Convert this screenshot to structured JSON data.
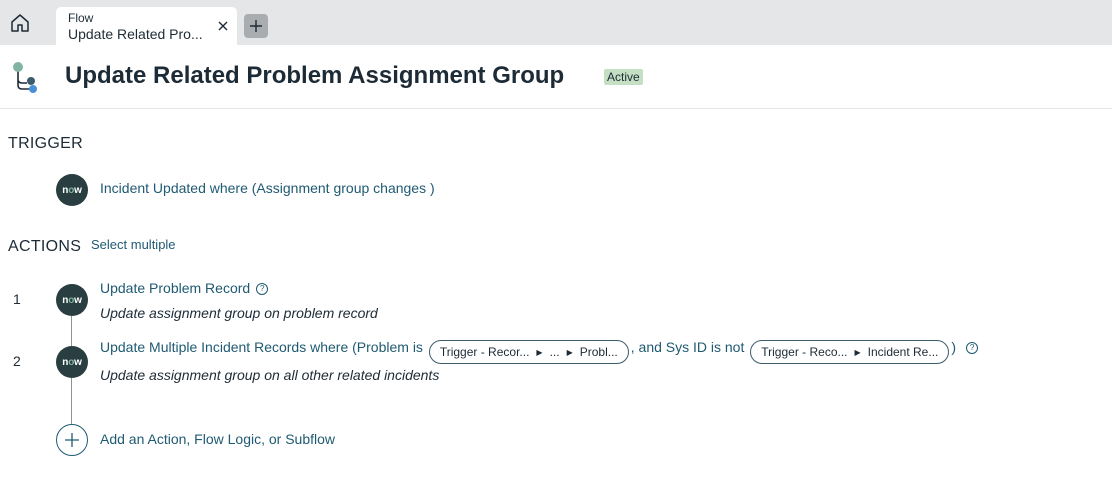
{
  "tabbar": {
    "home_icon": "home-icon",
    "tab": {
      "type_label": "Flow",
      "title": "Update Related Pro..."
    },
    "close_icon": "close-icon",
    "new_tab_icon": "plus-icon"
  },
  "header": {
    "icon": "flow-icon",
    "title": "Update Related Problem Assignment Group",
    "status": "Active"
  },
  "trigger": {
    "section_label": "TRIGGER",
    "text": "Incident Updated where (Assignment group changes )"
  },
  "actions": {
    "section_label": "ACTIONS",
    "select_multiple": "Select multiple",
    "steps": [
      {
        "number": "1",
        "title": "Update Problem Record",
        "description": "Update assignment group on problem record"
      },
      {
        "number": "2",
        "title_prefix": "Update Multiple Incident Records where (Problem is",
        "pill1": {
          "a": "Trigger - Recor...",
          "b": "...",
          "c": "Probl..."
        },
        "middle": ", and Sys ID is not",
        "pill2": {
          "a": "Trigger - Reco...",
          "b": "Incident Re..."
        },
        "suffix": ")",
        "description": "Update assignment group on all other related incidents"
      }
    ],
    "add_label": "Add an Action, Flow Logic, or Subflow"
  },
  "colors": {
    "link": "#1f5a72",
    "tabbar_bg": "#e4e6e7",
    "badge_bg": "#c4dfc3",
    "now_icon_bg": "#293e40"
  }
}
